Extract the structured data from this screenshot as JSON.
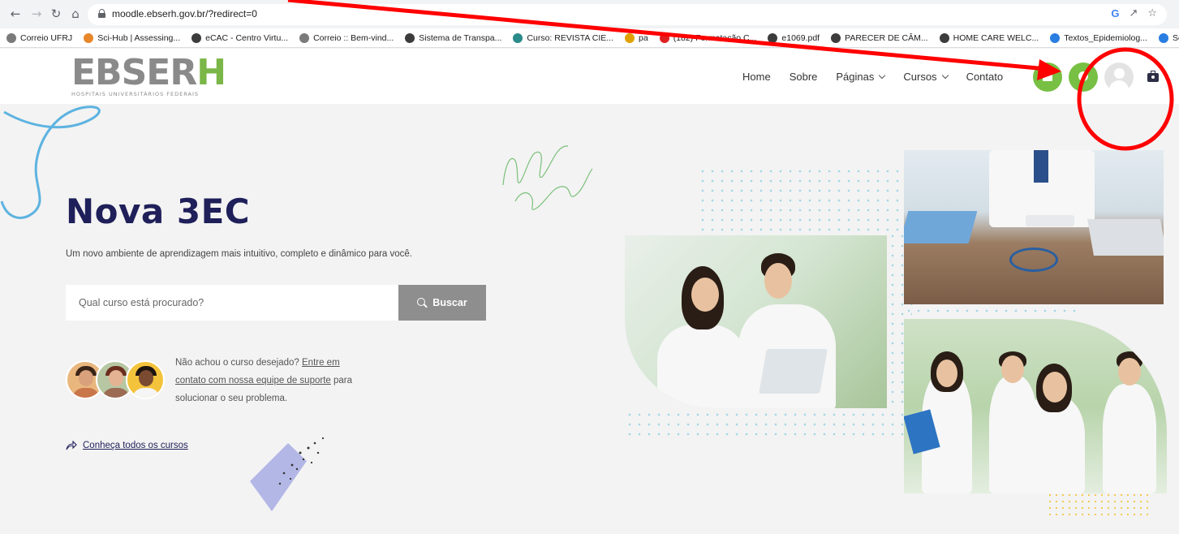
{
  "browser": {
    "url": "moodle.ebserh.gov.br/?redirect=0",
    "bookmarks": [
      {
        "label": "Correio UFRJ",
        "color": "#7a7a7a"
      },
      {
        "label": "Sci-Hub | Assessing...",
        "color": "#e8862a"
      },
      {
        "label": "eCAC - Centro Virtu...",
        "color": "#3c3c3c"
      },
      {
        "label": "Correio :: Bem-vind...",
        "color": "#7a7a7a"
      },
      {
        "label": "Sistema de Transpa...",
        "color": "#3c3c3c"
      },
      {
        "label": "Curso: REVISTA CIE...",
        "color": "#2b8a8a"
      },
      {
        "label": "pa",
        "color": "#e0a100"
      },
      {
        "label": "(182) Formatação C...",
        "color": "#e02020"
      },
      {
        "label": "e1069.pdf",
        "color": "#3c3c3c"
      },
      {
        "label": "PARECER DE CÂM...",
        "color": "#3c3c3c"
      },
      {
        "label": "HOME CARE WELC...",
        "color": "#3c3c3c"
      },
      {
        "label": "Textos_Epidemiolog...",
        "color": "#2a7de1"
      },
      {
        "label": "Segurança",
        "color": "#2a7de1"
      }
    ]
  },
  "site": {
    "logo_main": "EBSER",
    "logo_accent": "H",
    "logo_tagline": "HOSPITAIS UNIVERSITÁRIOS FEDERAIS",
    "nav": [
      {
        "label": "Home",
        "dropdown": false
      },
      {
        "label": "Sobre",
        "dropdown": false
      },
      {
        "label": "Páginas",
        "dropdown": true
      },
      {
        "label": "Cursos",
        "dropdown": true
      },
      {
        "label": "Contato",
        "dropdown": false
      }
    ],
    "accent_color": "#77c043"
  },
  "hero": {
    "title": "Nova 3EC",
    "subtitle": "Um novo ambiente de aprendizagem mais intuitivo, completo e dinâmico para você.",
    "search_placeholder": "Qual curso está procurado?",
    "search_button": "Buscar",
    "help_prefix": "Não achou o curso desejado? ",
    "help_link": "Entre em contato com nossa equipe de suporte",
    "help_suffix": " para solucionar o seu problema.",
    "all_courses": "Conheça todos os cursos"
  },
  "annotation": {
    "color": "#ff0000",
    "target": "user-menu-area"
  }
}
